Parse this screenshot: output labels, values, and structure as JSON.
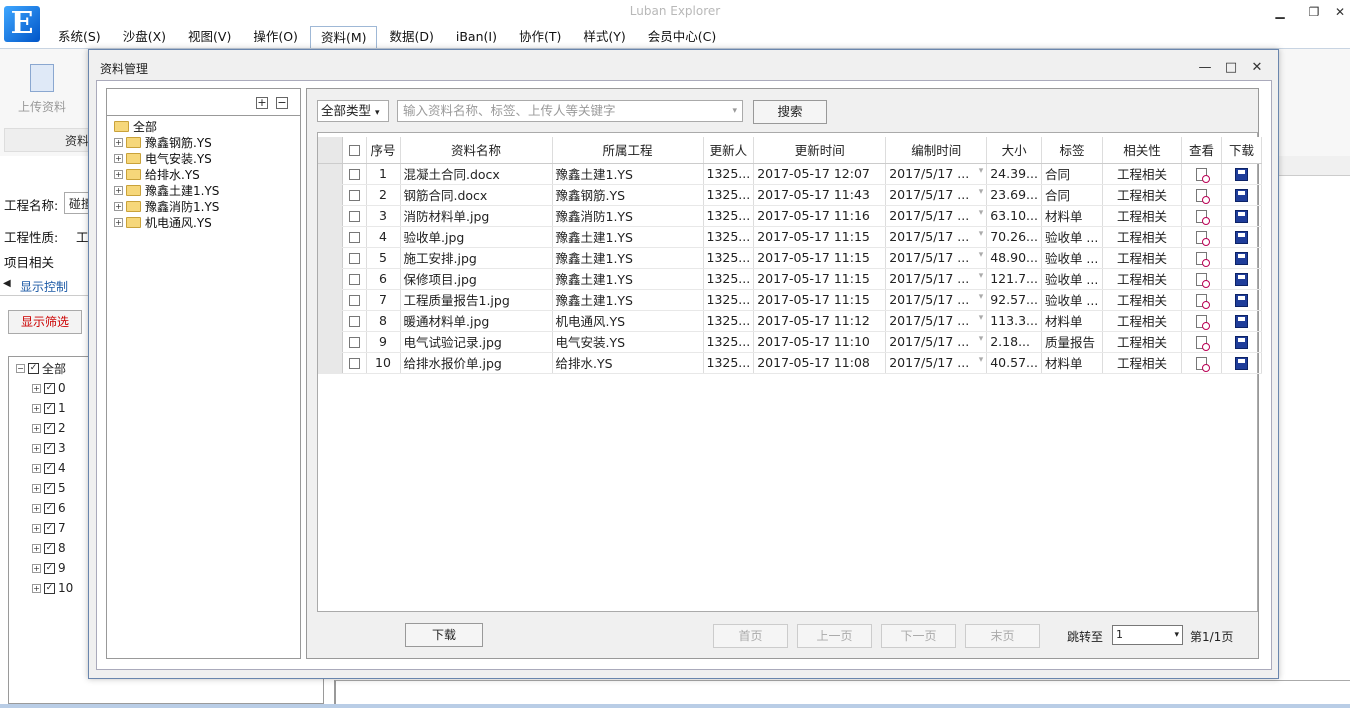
{
  "app": {
    "title": "Luban Explorer",
    "logo": "E",
    "min": "▁",
    "restore": "❐",
    "close": "✕"
  },
  "menu": [
    "系统(S)",
    "沙盘(X)",
    "视图(V)",
    "操作(O)",
    "资料(M)",
    "数据(D)",
    "iBan(I)",
    "协作(T)",
    "样式(Y)",
    "会员中心(C)"
  ],
  "ribbon": {
    "upload_label": "上传资料",
    "group_label": "资料"
  },
  "left": {
    "project_name_label": "工程名称:",
    "project_name_value": "碰撞",
    "project_type_label": "工程性质:",
    "project_type_value": "工",
    "project_related": "项目相关",
    "tab_display": "显示控制",
    "filter_btn": "显示筛选",
    "layer_root": "全部",
    "layers": [
      "0",
      "1",
      "2",
      "3",
      "4",
      "5",
      "6",
      "7",
      "8",
      "9",
      "10"
    ]
  },
  "dialog": {
    "title": "资料管理",
    "min": "—",
    "max": "□",
    "close": "✕",
    "tree": {
      "expand": "+",
      "collapse": "−",
      "root": "全部",
      "items": [
        "豫鑫钢筋.YS",
        "电气安装.YS",
        "给排水.YS",
        "豫鑫土建1.YS",
        "豫鑫消防1.YS",
        "机电通风.YS"
      ]
    },
    "filter": {
      "type": "全部类型",
      "type_arrow": "▾",
      "search_placeholder": "输入资料名称、标签、上传人等关键字",
      "search_arrow": "▾",
      "search_btn": "搜索"
    },
    "table": {
      "headers": [
        "序号",
        "资料名称",
        "所属工程",
        "更新人",
        "更新时间",
        "编制时间",
        "大小",
        "标签",
        "相关性",
        "查看",
        "下载"
      ],
      "rows": [
        {
          "no": "1",
          "name": "混凝土合同.docx",
          "project": "豫鑫土建1.YS",
          "user": "1325...",
          "updated": "2017-05-17 12:07",
          "compiled": "2017/5/17 ...",
          "size": "24.39...",
          "tag": "合同",
          "rel": "工程相关"
        },
        {
          "no": "2",
          "name": "钢筋合同.docx",
          "project": "豫鑫钢筋.YS",
          "user": "1325...",
          "updated": "2017-05-17 11:43",
          "compiled": "2017/5/17 ...",
          "size": "23.69...",
          "tag": "合同",
          "rel": "工程相关"
        },
        {
          "no": "3",
          "name": "消防材料单.jpg",
          "project": "豫鑫消防1.YS",
          "user": "1325...",
          "updated": "2017-05-17 11:16",
          "compiled": "2017/5/17 ...",
          "size": "63.10...",
          "tag": "材料单",
          "rel": "工程相关"
        },
        {
          "no": "4",
          "name": "验收单.jpg",
          "project": "豫鑫土建1.YS",
          "user": "1325...",
          "updated": "2017-05-17 11:15",
          "compiled": "2017/5/17 ...",
          "size": "70.26...",
          "tag": "验收单 ...",
          "rel": "工程相关"
        },
        {
          "no": "5",
          "name": "施工安排.jpg",
          "project": "豫鑫土建1.YS",
          "user": "1325...",
          "updated": "2017-05-17 11:15",
          "compiled": "2017/5/17 ...",
          "size": "48.90...",
          "tag": "验收单 ...",
          "rel": "工程相关"
        },
        {
          "no": "6",
          "name": "保修项目.jpg",
          "project": "豫鑫土建1.YS",
          "user": "1325...",
          "updated": "2017-05-17 11:15",
          "compiled": "2017/5/17 ...",
          "size": "121.7...",
          "tag": "验收单 ...",
          "rel": "工程相关"
        },
        {
          "no": "7",
          "name": "工程质量报告1.jpg",
          "project": "豫鑫土建1.YS",
          "user": "1325...",
          "updated": "2017-05-17 11:15",
          "compiled": "2017/5/17 ...",
          "size": "92.57...",
          "tag": "验收单 ...",
          "rel": "工程相关"
        },
        {
          "no": "8",
          "name": "暖通材料单.jpg",
          "project": "机电通风.YS",
          "user": "1325...",
          "updated": "2017-05-17 11:12",
          "compiled": "2017/5/17 ...",
          "size": "113.3...",
          "tag": "材料单",
          "rel": "工程相关"
        },
        {
          "no": "9",
          "name": "电气试验记录.jpg",
          "project": "电气安装.YS",
          "user": "1325...",
          "updated": "2017-05-17 11:10",
          "compiled": "2017/5/17 ...",
          "size": "2.18...",
          "tag": "质量报告",
          "rel": "工程相关"
        },
        {
          "no": "10",
          "name": "给排水报价单.jpg",
          "project": "给排水.YS",
          "user": "1325...",
          "updated": "2017-05-17 11:08",
          "compiled": "2017/5/17 ...",
          "size": "40.57...",
          "tag": "材料单",
          "rel": "工程相关"
        }
      ]
    },
    "footer": {
      "download": "下载",
      "first": "首页",
      "prev": "上一页",
      "next": "下一页",
      "last": "末页",
      "jump": "跳转至",
      "page_value": "1",
      "page_arrow": "▾",
      "page_info": "第1/1页"
    }
  }
}
